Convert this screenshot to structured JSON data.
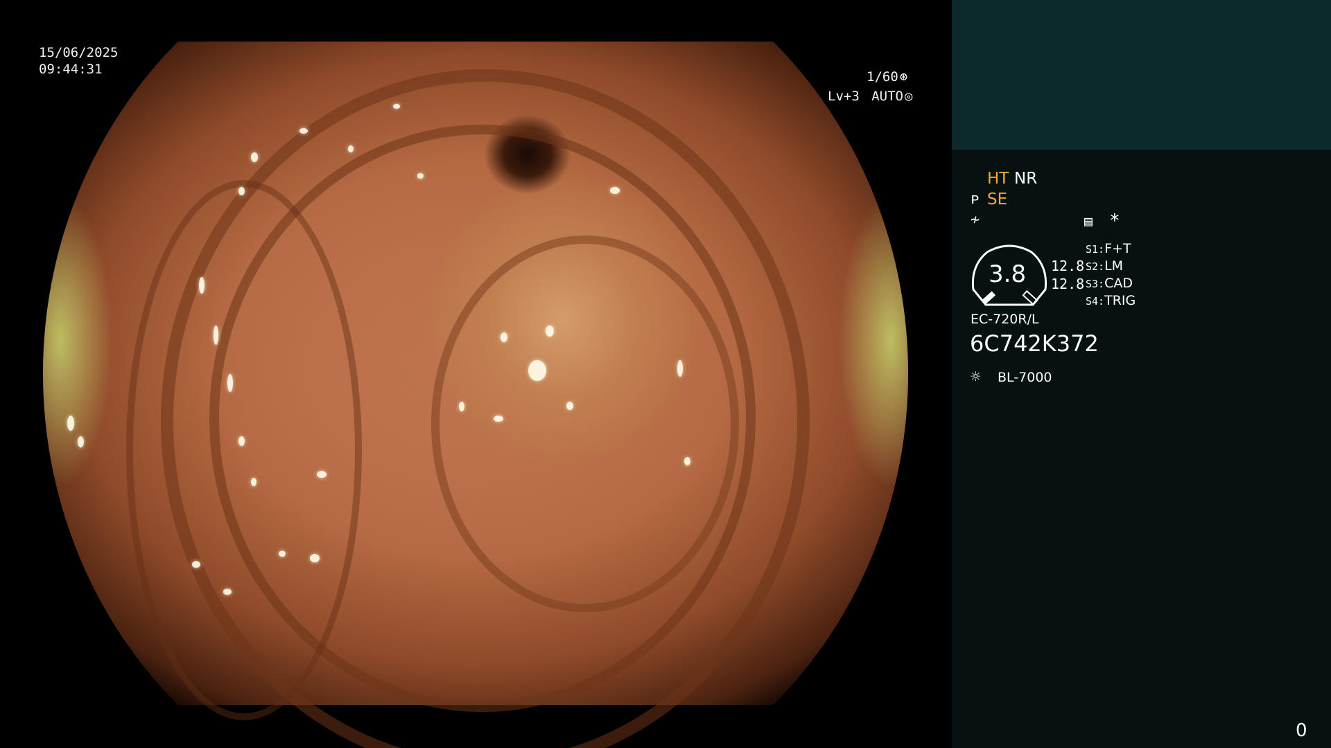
{
  "overlay": {
    "date": "15/06/2025",
    "time": "09:44:31",
    "shutter": "1/60",
    "shutter_icon": "shutter-icon",
    "level": "Lv+3",
    "auto": "AUTO",
    "auto_icon": "iris-icon"
  },
  "panel": {
    "colors": {
      "background": "#071111",
      "top_block": "#0c2a2c",
      "accent": "#f2a93b"
    },
    "mode_ht": "HT",
    "mode_nr": "NR",
    "mode_se": "SE",
    "se_icon": "enhance-icon",
    "sharpness_icon": "sharpness-icon",
    "memory_icon": "memory-card-icon",
    "asterisk": "*",
    "gauge_value": "3.8",
    "side_value_1": "12.8",
    "side_value_2": "12.8",
    "switches": [
      {
        "key": "S1:",
        "value": "F+T"
      },
      {
        "key": "S2:",
        "value": "LM"
      },
      {
        "key": "S3:",
        "value": "CAD"
      },
      {
        "key": "S4:",
        "value": "TRIG"
      }
    ],
    "scope_model": "EC-720R/L",
    "serial": "6C742K372",
    "light_icon": "light-source-icon",
    "light_source": "BL-7000",
    "counter": "0"
  }
}
